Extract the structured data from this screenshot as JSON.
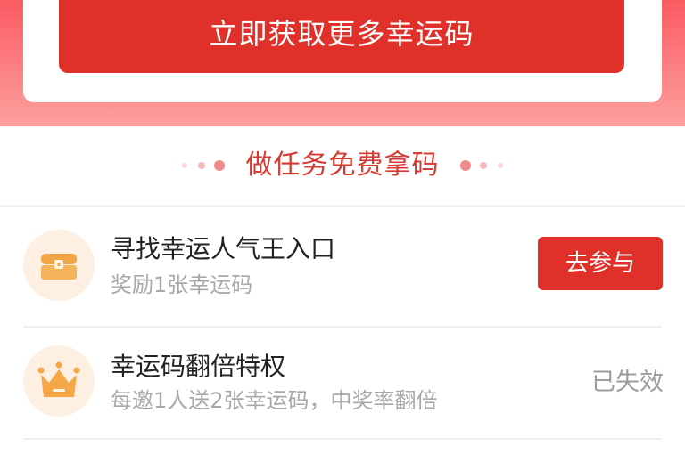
{
  "banner": {
    "cta_label": "立即获取更多幸运码"
  },
  "section": {
    "title": "做任务免费拿码"
  },
  "tasks": [
    {
      "title": "寻找幸运人气王入口",
      "subtitle": "奖励1张幸运码",
      "action_label": "去参与",
      "icon": "treasure-chest-icon"
    },
    {
      "title": "幸运码翻倍特权",
      "subtitle": "每邀1人送2张幸运码，中奖率翻倍",
      "status_label": "已失效",
      "icon": "crown-icon"
    }
  ],
  "colors": {
    "accent": "#e0302a",
    "title_red": "#d63a32",
    "icon_bg": "#fdefe2",
    "icon_fg": "#f5a747"
  }
}
